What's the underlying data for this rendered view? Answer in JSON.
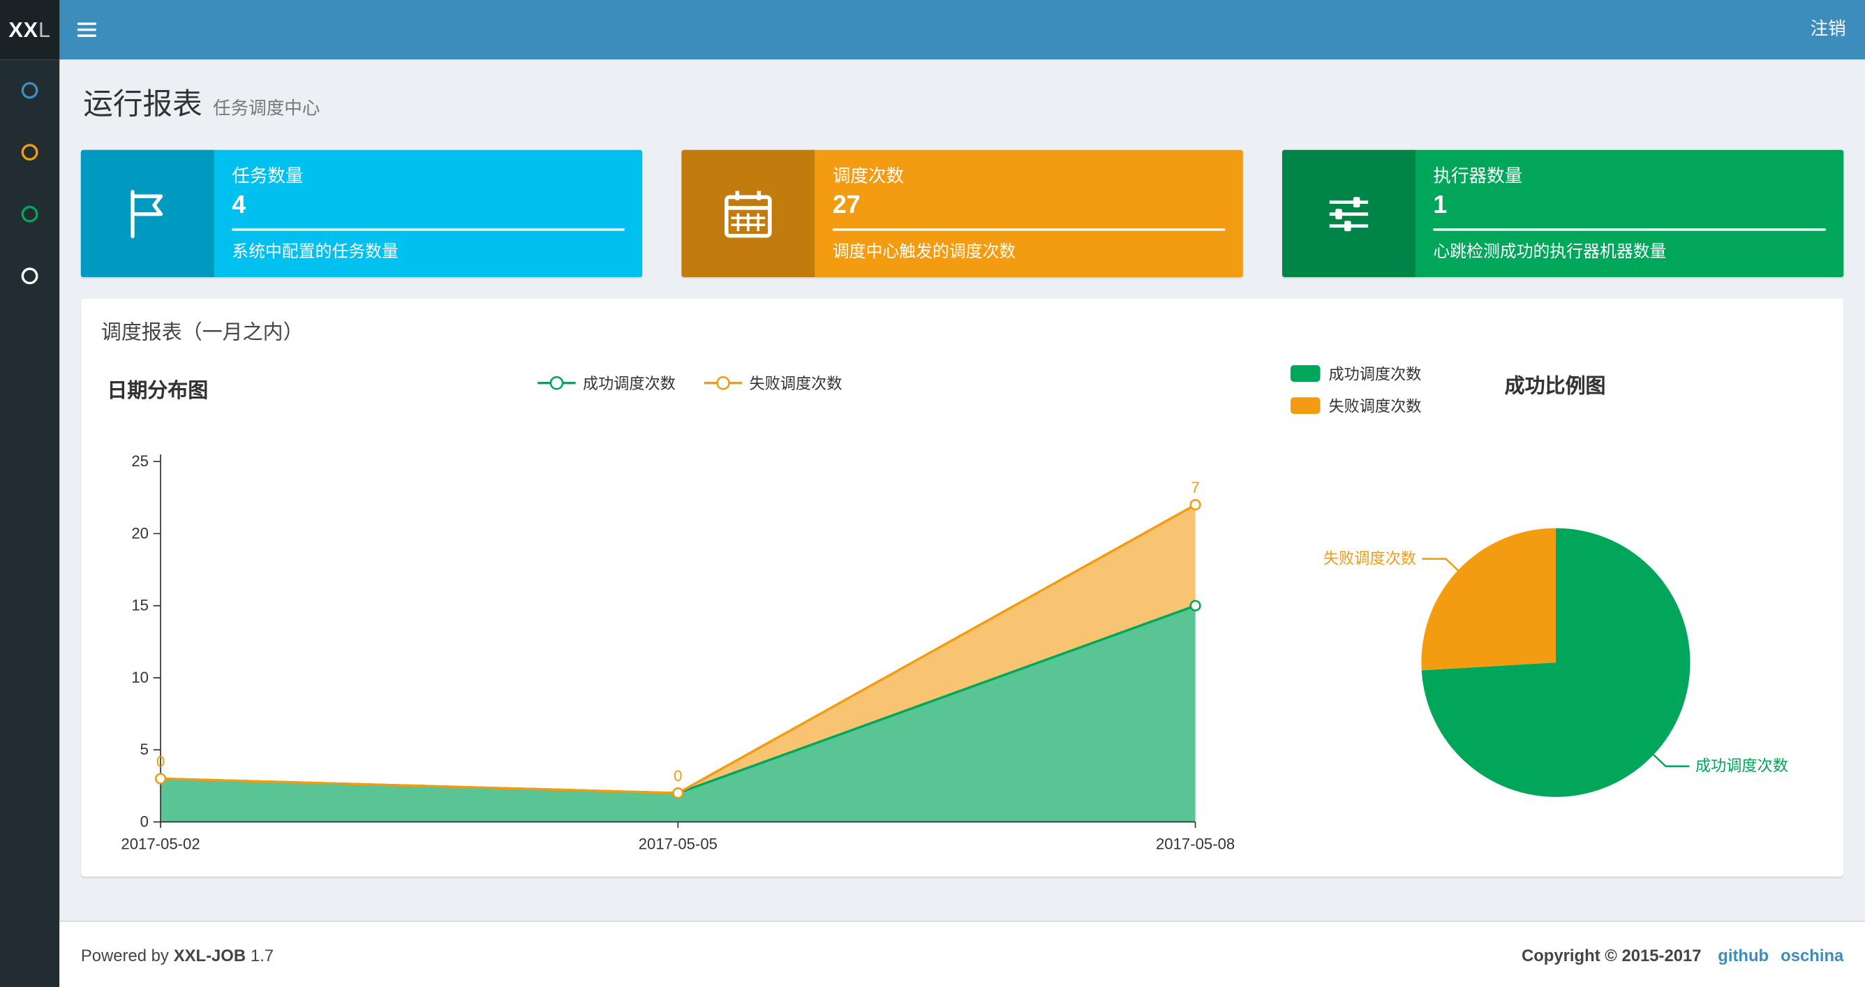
{
  "navbar": {
    "logo_bold": "XX",
    "logo_light": "L",
    "logout_label": "注销"
  },
  "sidebar": {
    "items": [
      {
        "icon": "circle-icon",
        "color": "#3c8dbc"
      },
      {
        "icon": "circle-icon",
        "color": "#f39c12"
      },
      {
        "icon": "circle-icon",
        "color": "#00a65a"
      },
      {
        "icon": "circle-icon",
        "color": "#ffffff"
      }
    ]
  },
  "header": {
    "title": "运行报表",
    "subtitle": "任务调度中心"
  },
  "info_boxes": [
    {
      "icon": "flag-icon",
      "color": "#00c0ef",
      "label": "任务数量",
      "value": "4",
      "desc": "系统中配置的任务数量"
    },
    {
      "icon": "calendar-icon",
      "color": "#f39c12",
      "label": "调度次数",
      "value": "27",
      "desc": "调度中心触发的调度次数"
    },
    {
      "icon": "sliders-icon",
      "color": "#00a65a",
      "label": "执行器数量",
      "value": "1",
      "desc": "心跳检测成功的执行器机器数量"
    }
  ],
  "panel": {
    "title": "调度报表（一月之内）"
  },
  "chart_data": [
    {
      "type": "area",
      "title": "日期分布图",
      "stacked": true,
      "x": [
        "2017-05-02",
        "2017-05-05",
        "2017-05-08"
      ],
      "series": [
        {
          "name": "成功调度次数",
          "color": "#00a65a",
          "values": [
            3,
            2,
            15
          ]
        },
        {
          "name": "失败调度次数",
          "color": "#f39c12",
          "values": [
            0,
            0,
            7
          ],
          "point_labels": [
            "0",
            "0",
            "7"
          ]
        }
      ],
      "ylim": [
        0,
        25
      ],
      "yticks": [
        0,
        5,
        10,
        15,
        20,
        25
      ],
      "legend_position": "top-center",
      "grid": false
    },
    {
      "type": "pie",
      "title": "成功比例图",
      "slices": [
        {
          "name": "成功调度次数",
          "color": "#00a65a",
          "value": 20
        },
        {
          "name": "失败调度次数",
          "color": "#f39c12",
          "value": 7
        }
      ],
      "start_angle": "top",
      "direction": "clockwise",
      "legend_position": "top-left"
    }
  ],
  "footer": {
    "powered_prefix": "Powered by",
    "powered_brand": "XXL-JOB",
    "powered_version": "1.7",
    "copyright": "Copyright © 2015-2017",
    "links": [
      "github",
      "oschina"
    ]
  }
}
